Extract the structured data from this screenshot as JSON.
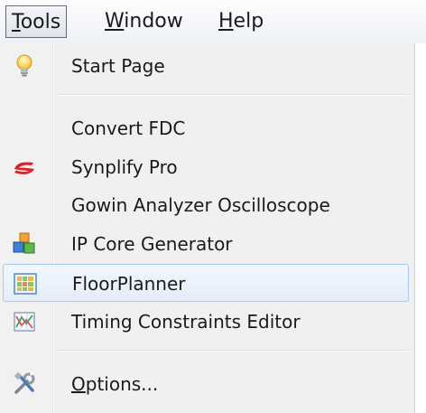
{
  "menubar": {
    "tools": {
      "mnemonic": "T",
      "rest": "ools"
    },
    "window": {
      "mnemonic": "W",
      "rest": "indow"
    },
    "help": {
      "mnemonic": "H",
      "rest": "elp"
    }
  },
  "tools_menu": {
    "items": [
      {
        "label": "Start Page",
        "icon": "lightbulb-icon"
      },
      {
        "label": "Convert FDC",
        "icon": ""
      },
      {
        "label": "Synplify Pro",
        "icon": "synplify-logo-icon"
      },
      {
        "label": "Gowin Analyzer Oscilloscope",
        "icon": ""
      },
      {
        "label": "IP Core Generator",
        "icon": "ip-core-blocks-icon"
      },
      {
        "label": "FloorPlanner",
        "icon": "floorplanner-grid-icon",
        "highlighted": true
      },
      {
        "label": "Timing Constraints Editor",
        "icon": "timing-chart-icon"
      },
      {
        "label_mnemonic": "O",
        "label_rest": "ptions...",
        "icon": "tools-icon"
      }
    ]
  },
  "colors": {
    "highlight_border": "#a8c8ec",
    "highlight_fill": "#e2edfa",
    "menu_background": "#f0f0f0",
    "synplify_red": "#d8232a"
  }
}
